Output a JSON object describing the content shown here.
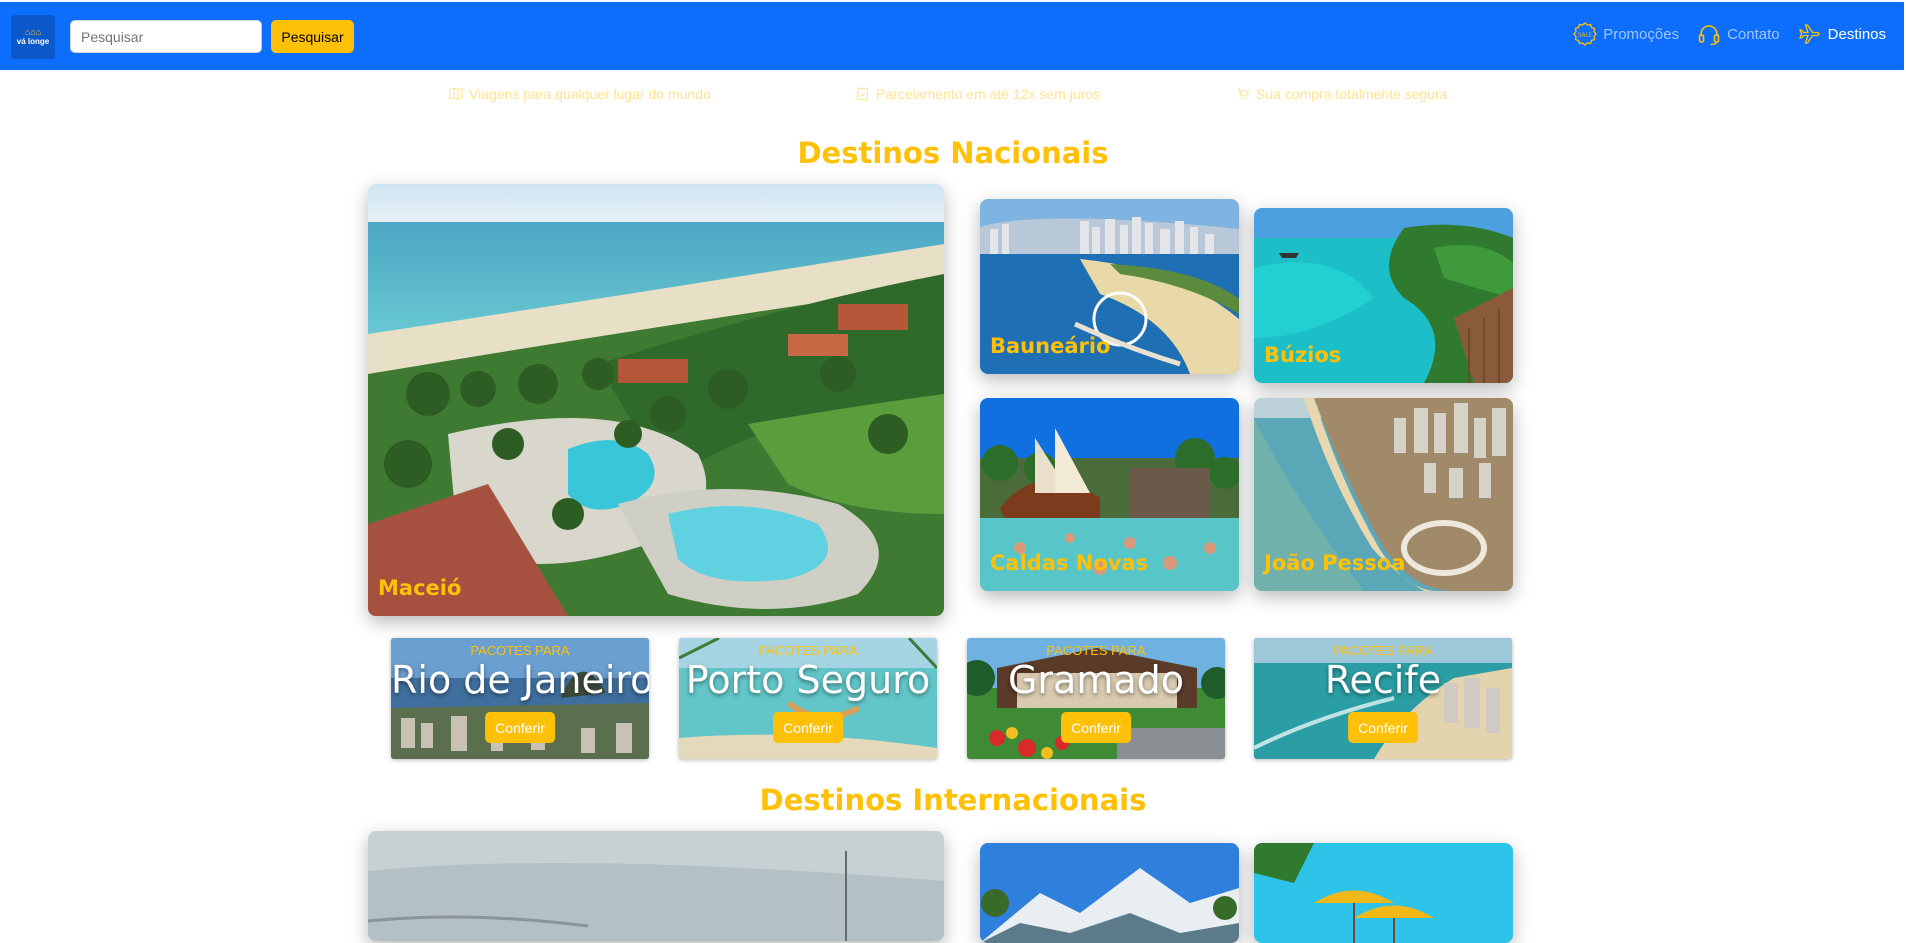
{
  "header": {
    "logo_text": "vá longe",
    "search_placeholder": "Pesquisar",
    "search_button": "Pesquisar",
    "nav": [
      {
        "label": "Promoções",
        "icon": "sale-badge-icon"
      },
      {
        "label": "Contato",
        "icon": "headset-icon"
      },
      {
        "label": "Destinos",
        "icon": "airplane-icon",
        "active": true
      }
    ]
  },
  "features": [
    {
      "text": "Viagens para qualquer lugar do mundo",
      "icon": "map-icon"
    },
    {
      "text": "Parcelamento em até 12x sem juros",
      "icon": "card-check-icon"
    },
    {
      "text": "Sua compra totalmente segura",
      "icon": "secure-cart-icon"
    }
  ],
  "nacionais": {
    "title": "Destinos Nacionais",
    "main": {
      "label": "Maceió"
    },
    "grid": [
      {
        "label": "Bauneário"
      },
      {
        "label": "Búzios"
      },
      {
        "label": "Caldas Novas"
      },
      {
        "label": "João Pessoa"
      }
    ]
  },
  "pacotes": {
    "prefix": "PACOTES PARA",
    "button": "Conferir",
    "items": [
      {
        "city": "Rio de Janeiro"
      },
      {
        "city": "Porto Seguro"
      },
      {
        "city": "Gramado"
      },
      {
        "city": "Recife"
      }
    ]
  },
  "internacionais": {
    "title": "Destinos Internacionais"
  },
  "colors": {
    "navbar": "#0d6efd",
    "accent": "#ffc107"
  }
}
